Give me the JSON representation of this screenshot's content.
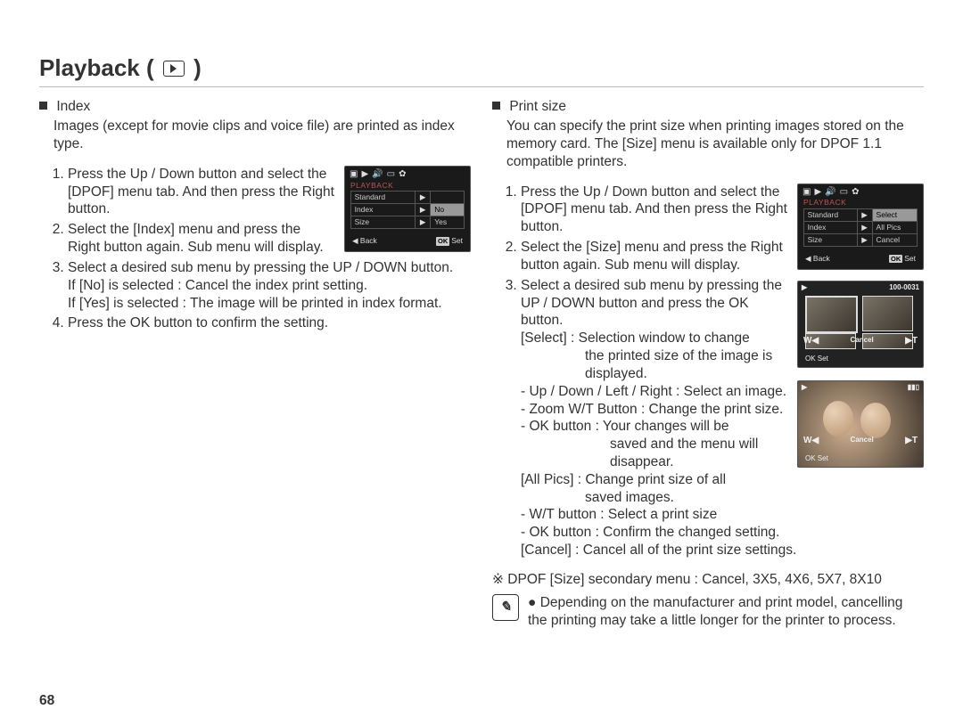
{
  "page_number": "68",
  "title": "Playback (",
  "title_tail": ")",
  "left": {
    "heading": "Index",
    "intro": "Images (except for movie clips and voice file) are printed as index type.",
    "steps": [
      "Press the Up / Down button and select the [DPOF] menu tab. And then press the Right button.",
      "Select the [Index] menu and press the Right button again. Sub menu will display.",
      "Select a desired sub menu by pressing the UP / DOWN button.",
      "Press the OK button to confirm the setting."
    ],
    "step3_lines": [
      "If [No] is selected   : Cancel the index print setting.",
      "If [Yes] is selected : The image will be printed in index format."
    ],
    "menu": {
      "section": "PLAYBACK",
      "rows": [
        [
          "Standard",
          ""
        ],
        [
          "Index",
          "No"
        ],
        [
          "Size",
          "Yes"
        ]
      ],
      "back": "Back",
      "set": "Set"
    }
  },
  "right": {
    "heading": "Print size",
    "intro": "You can specify the print size when printing images stored on the memory card. The [Size] menu is available only for DPOF 1.1 compatible printers.",
    "steps": [
      "Press the Up / Down button and select the [DPOF] menu tab. And then press the Right button.",
      "Select the [Size] menu and press the Right button again. Sub menu will display.",
      "Select a desired sub menu by pressing the UP / DOWN button and press the OK button."
    ],
    "select_label": "[Select] : Selection window to change",
    "select_line2": "the printed size of the image is displayed.",
    "select_sub": [
      "- Up / Down / Left / Right : Select an image.",
      "- Zoom W/T Button : Change the print size.",
      "- OK button : Your changes will be"
    ],
    "ok_cont": "saved and the menu will disappear.",
    "allpics_label": "[All Pics] : Change print size of all",
    "allpics_line2": "saved images.",
    "allpics_sub": [
      "- W/T button : Select a print size",
      "- OK button : Confirm the changed setting."
    ],
    "cancel_line": "[Cancel] : Cancel all of the print size settings.",
    "secondary": "※ DPOF [Size] secondary menu : Cancel, 3X5, 4X6, 5X7, 8X10",
    "note_bullet": "●",
    "note": "Depending on the manufacturer and print model, cancelling the printing may take a little longer for the printer to process.",
    "menu": {
      "section": "PLAYBACK",
      "rows": [
        [
          "Standard",
          "Select"
        ],
        [
          "Index",
          "All Pics"
        ],
        [
          "Size",
          "Cancel"
        ]
      ],
      "back": "Back",
      "set": "Set"
    },
    "shot_top": {
      "idlabel": "100-0031",
      "w": "W◀",
      "t": "▶T",
      "center": "Cancel",
      "set": "Set"
    },
    "shot_bottom": {
      "w": "W◀",
      "t": "▶T",
      "center": "Cancel",
      "set": "Set"
    }
  }
}
